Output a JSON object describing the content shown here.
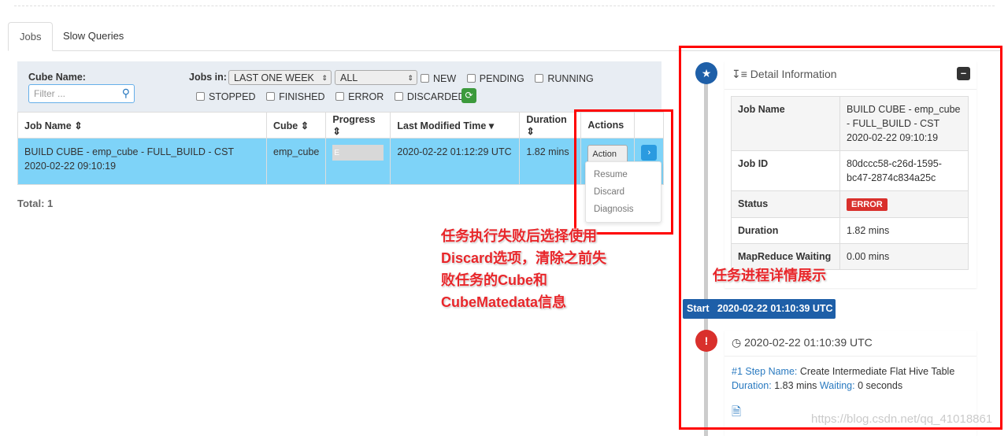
{
  "tabs": [
    {
      "label": "Jobs",
      "active": true
    },
    {
      "label": "Slow Queries",
      "active": false
    }
  ],
  "filter": {
    "cube_name_label": "Cube Name:",
    "cube_name_placeholder": "Filter ...",
    "jobs_in_label": "Jobs in:",
    "time_range": "LAST ONE WEEK",
    "scope": "ALL",
    "statuses": [
      "NEW",
      "PENDING",
      "RUNNING",
      "STOPPED",
      "FINISHED",
      "ERROR",
      "DISCARDED"
    ]
  },
  "table": {
    "headers": [
      "Job Name",
      "Cube",
      "Progress",
      "Last Modified Time",
      "Duration",
      "Actions"
    ],
    "rows": [
      {
        "job_name": "BUILD CUBE - emp_cube - FULL_BUILD - CST 2020-02-22 09:10:19",
        "cube": "emp_cube",
        "progress": "E",
        "last_modified": "2020-02-22 01:12:29 UTC",
        "duration": "1.82 mins",
        "action": "Action"
      }
    ],
    "action_menu": [
      "Resume",
      "Discard",
      "Diagnosis"
    ],
    "total": "Total: 1"
  },
  "annotations": {
    "left_lines": [
      "任务执行失败后选择使用",
      "Discard选项，清除之前失",
      "败任务的Cube和",
      "CubeMatedata信息"
    ],
    "right": "任务进程详情展示",
    "highlight_color": "#ff0000"
  },
  "detail": {
    "title": "Detail Information",
    "rows": [
      {
        "key": "Job Name",
        "value": "BUILD CUBE - emp_cube - FULL_BUILD - CST 2020-02-22 09:10:19"
      },
      {
        "key": "Job ID",
        "value": "80dccc58-c26d-1595-bc47-2874c834a25c"
      },
      {
        "key": "Status",
        "value": "ERROR"
      },
      {
        "key": "Duration",
        "value": "1.82 mins"
      },
      {
        "key": "MapReduce Waiting",
        "value": "0.00 mins"
      }
    ],
    "start_label": "Start",
    "start_time": "2020-02-22 01:10:39 UTC",
    "step": {
      "time": "2020-02-22 01:10:39 UTC",
      "step_name_label": "#1 Step Name:",
      "step_name": "Create Intermediate Flat Hive Table",
      "duration_label": "Duration:",
      "duration": "1.83 mins",
      "waiting_label": "Waiting:",
      "waiting": "0 seconds"
    }
  },
  "watermark": "https://blog.csdn.net/qq_41018861"
}
